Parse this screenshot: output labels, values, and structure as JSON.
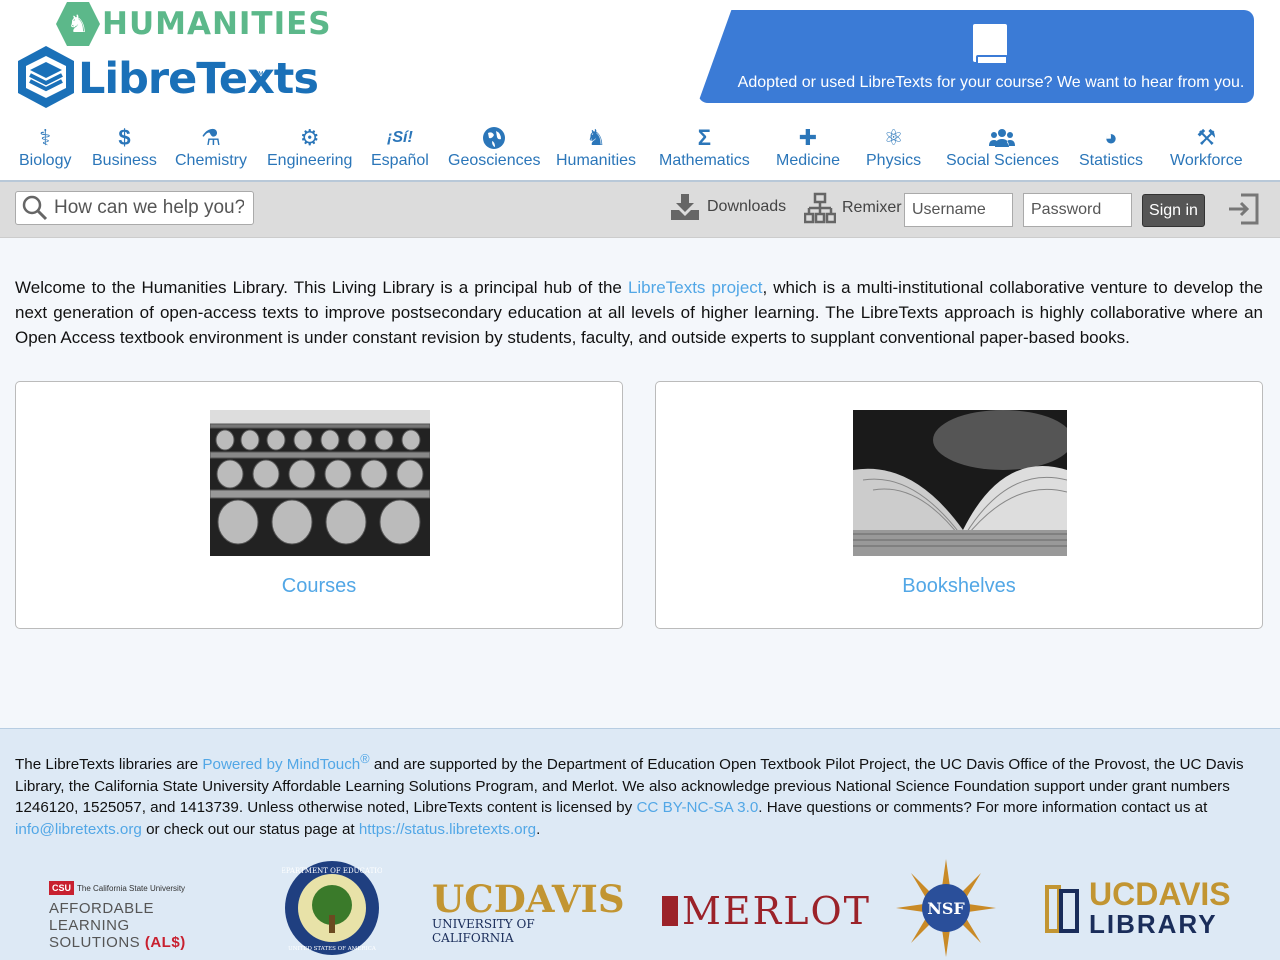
{
  "header": {
    "library_name": "HUMANITIES",
    "logo_text": "LibreTexts",
    "logo_tm": "™",
    "promo_text": "Adopted or used LibreTexts for your course? We want to hear from you."
  },
  "subjects": [
    {
      "label": "Biology",
      "icon": "dna-icon",
      "glyph": "⚕"
    },
    {
      "label": "Business",
      "icon": "dollar-icon",
      "glyph": "$"
    },
    {
      "label": "Chemistry",
      "icon": "flask-icon",
      "glyph": "⚗"
    },
    {
      "label": "Engineering",
      "icon": "gear-icon",
      "glyph": "⚙"
    },
    {
      "label": "Español",
      "icon": "si-icon",
      "glyph": "¡Sí!"
    },
    {
      "label": "Geosciences",
      "icon": "globe-icon",
      "glyph": "🌐"
    },
    {
      "label": "Humanities",
      "icon": "bust-icon",
      "glyph": "♞"
    },
    {
      "label": "Mathematics",
      "icon": "sigma-icon",
      "glyph": "Σ"
    },
    {
      "label": "Medicine",
      "icon": "plus-icon",
      "glyph": "✚"
    },
    {
      "label": "Physics",
      "icon": "atom-icon",
      "glyph": "⚛"
    },
    {
      "label": "Social Sciences",
      "icon": "users-icon",
      "glyph": "👥"
    },
    {
      "label": "Statistics",
      "icon": "pie-chart-icon",
      "glyph": "◕"
    },
    {
      "label": "Workforce",
      "icon": "tools-icon",
      "glyph": "⚒"
    }
  ],
  "toolbar": {
    "search_placeholder": "How can we help you?",
    "downloads_label": "Downloads",
    "remixer_label": "Remixer",
    "username_placeholder": "Username",
    "password_placeholder": "Password",
    "signin_label": "Sign in"
  },
  "main": {
    "welcome_pre": "Welcome to the Humanities Library. This Living Library is a principal hub of the ",
    "welcome_link": "LibreTexts project",
    "welcome_post": ", which is a multi-institutional collaborative venture to develop the next generation of open-access texts to improve postsecondary education at all levels of higher learning. The LibreTexts approach is highly collaborative where an Open Access textbook environment is under constant revision by students, faculty, and outside experts to supplant conventional paper-based books.",
    "cards": [
      {
        "title": "Courses"
      },
      {
        "title": "Bookshelves"
      }
    ]
  },
  "footer": {
    "t1": "The LibreTexts libraries are ",
    "link1": "Powered by MindTouch",
    "reg": "®",
    "t2": " and are supported by the Department of Education Open Textbook Pilot Project, the UC Davis Office of the Provost, the UC Davis Library, the California State University Affordable Learning Solutions Program, and Merlot. We also acknowledge previous National Science Foundation support under grant numbers 1246120, 1525057, and 1413739. Unless otherwise noted, LibreTexts content is licensed by ",
    "link2": "CC BY-NC-SA 3.0",
    "t3": ". Have questions or comments? For more information contact us at ",
    "link3": "info@libretexts.org",
    "t4": " or check out our status page at ",
    "link4": "https://status.libretexts.org",
    "t5": ".",
    "partners": {
      "csu_badge": "CSU",
      "csu_name": "The California State University",
      "als_line1": "AFFORDABLE LEARNING",
      "als_line2": "SOLUTIONS",
      "als_tag": "(AL$)",
      "doe_top": "DEPARTMENT OF EDUCATION",
      "doe_bottom": "UNITED STATES OF AMERICA",
      "ucd_big": "UCDAVIS",
      "ucd_sub": "UNIVERSITY OF CALIFORNIA",
      "merlot": "MERLOT",
      "nsf": "NSF",
      "ucdlib_top": "UCDAVIS",
      "ucdlib_bottom": "LIBRARY"
    }
  },
  "colors": {
    "brand_blue": "#1a70b8",
    "link_blue": "#52a7e6",
    "humanities_green": "#5cb88a",
    "promo_blue": "#3b7bd6"
  }
}
